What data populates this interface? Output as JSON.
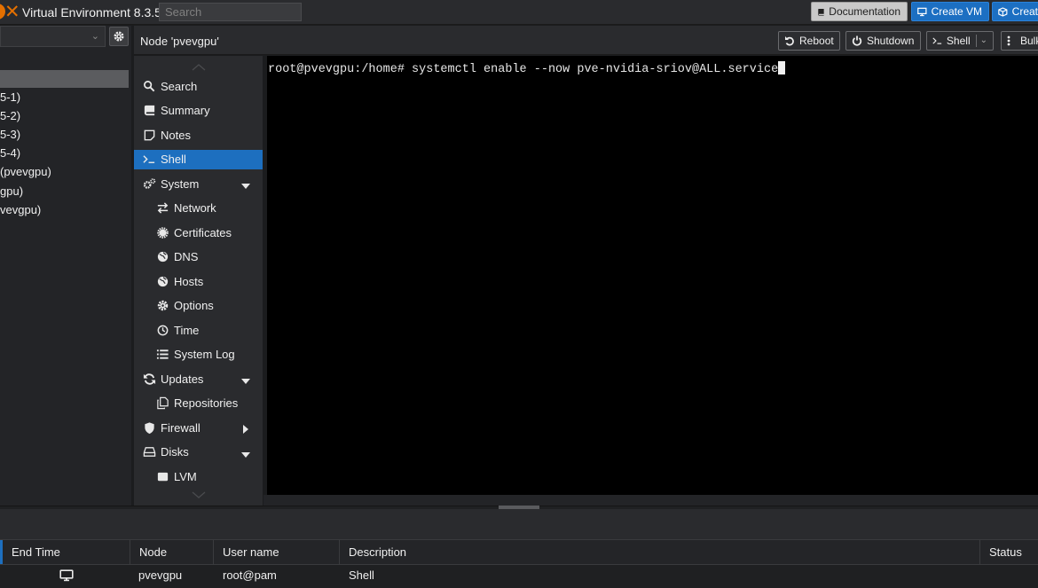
{
  "app": {
    "title": "Virtual Environment 8.3.5",
    "search_placeholder": "Search",
    "accent_color": "#e57000"
  },
  "topbar": {
    "documentation_label": "Documentation",
    "create_vm_label": "Create VM",
    "create_ct_label": "Creat",
    "primary_button_color": "#1c6fc2"
  },
  "tree": {
    "items": [
      {
        "label": "5-1)"
      },
      {
        "label": "5-2)"
      },
      {
        "label": "5-3)"
      },
      {
        "label": "5-4)"
      },
      {
        "label": " (pvevgpu)"
      },
      {
        "label": "gpu)"
      },
      {
        "label": "vevgpu)"
      }
    ]
  },
  "node": {
    "title": "Node 'pvevgpu'",
    "reboot_label": "Reboot",
    "shutdown_label": "Shutdown",
    "shell_label": "Shell",
    "bulk_label": "Bulk"
  },
  "menu": {
    "items": [
      {
        "label": "Search",
        "icon": "search-icon"
      },
      {
        "label": "Summary",
        "icon": "book-icon"
      },
      {
        "label": "Notes",
        "icon": "note-icon"
      },
      {
        "label": "Shell",
        "icon": "terminal-icon",
        "selected": true
      },
      {
        "label": "System",
        "icon": "cogs-icon",
        "expandable": "down"
      },
      {
        "label": "Network",
        "icon": "exchange-icon"
      },
      {
        "label": "Certificates",
        "icon": "certificate-icon"
      },
      {
        "label": "DNS",
        "icon": "globe-icon"
      },
      {
        "label": "Hosts",
        "icon": "globe-icon"
      },
      {
        "label": "Options",
        "icon": "gear-icon"
      },
      {
        "label": "Time",
        "icon": "clock-icon"
      },
      {
        "label": "System Log",
        "icon": "list-icon"
      },
      {
        "label": "Updates",
        "icon": "refresh-icon",
        "expandable": "down"
      },
      {
        "label": "Repositories",
        "icon": "files-icon"
      },
      {
        "label": "Firewall",
        "icon": "shield-icon",
        "expandable": "right"
      },
      {
        "label": "Disks",
        "icon": "hdd-icon",
        "expandable": "down"
      },
      {
        "label": "LVM",
        "icon": "square-icon"
      }
    ],
    "selected_color": "#1d6fbf"
  },
  "terminal": {
    "line": "root@pvevgpu:/home# systemctl enable --now pve-nvidia-sriov@ALL.service"
  },
  "log": {
    "columns": [
      "End Time",
      "Node",
      "User name",
      "Description",
      "Status"
    ],
    "rows": [
      {
        "end_time_icon": "monitor-icon",
        "node": "pvevgpu",
        "user": "root@pam",
        "description": "Shell",
        "status": ""
      }
    ]
  }
}
